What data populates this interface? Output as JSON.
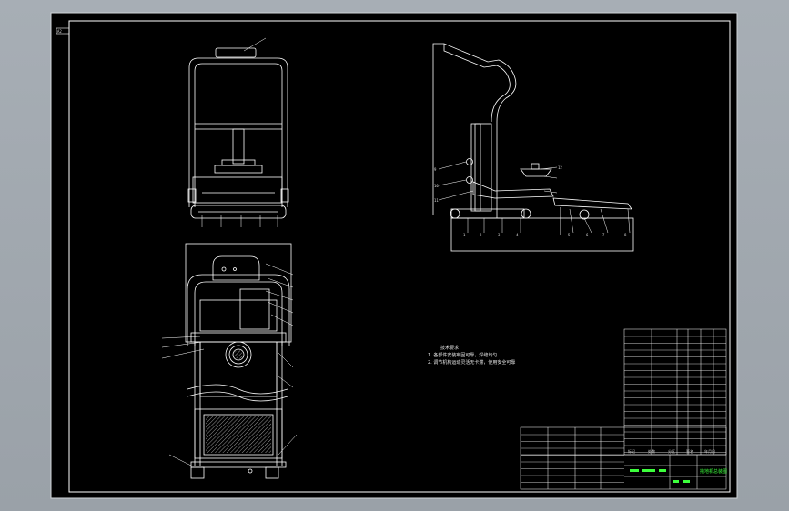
{
  "colors": {
    "background": "#a3aab1",
    "paper": "#000000",
    "line": "#ffffff",
    "accent": "#3cff3c",
    "frame": "#cfd4d8"
  },
  "corner_tag": "A2",
  "tech_requirements": {
    "title": "技术要求",
    "items": [
      "1. 各部件安装牢固可靠，焊缝均匀",
      "2. 调节机构运动灵活无卡滞，使用安全可靠"
    ]
  },
  "callouts_side": [
    "1",
    "2",
    "3",
    "4",
    "5",
    "6",
    "7",
    "8",
    "9",
    "10",
    "11",
    "12"
  ],
  "title_block": {
    "label": "拖地机总装图",
    "sub": [
      "标记",
      "处数",
      "分区",
      "签名",
      "年月日"
    ]
  }
}
